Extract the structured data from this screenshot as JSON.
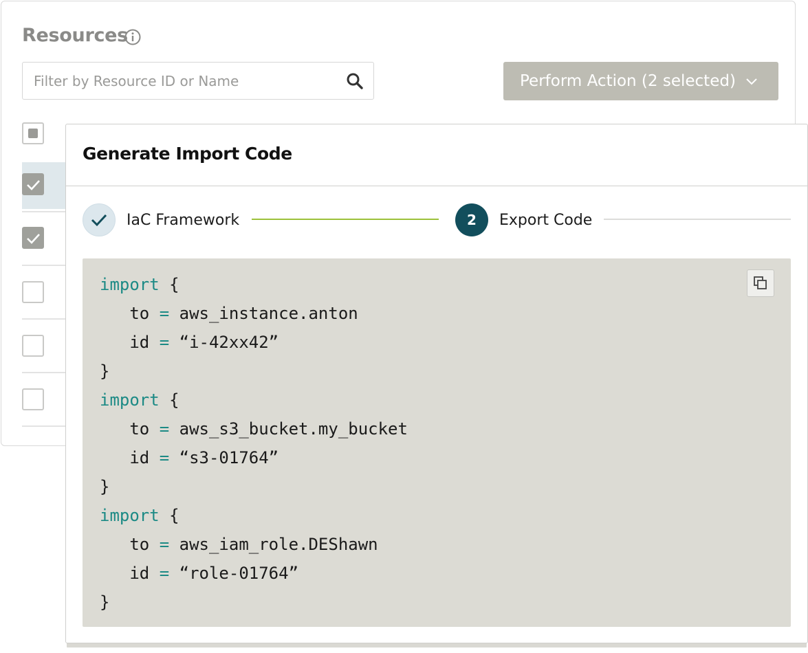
{
  "resources": {
    "title": "Resources",
    "info_icon": "info-icon",
    "search": {
      "placeholder": "Filter by Resource ID or Name",
      "value": "",
      "icon": "search-icon"
    },
    "action_button": {
      "label": "Perform Action (2 selected)",
      "icon": "chevron-down-icon"
    },
    "rows": [
      {
        "checked": "partial"
      },
      {
        "checked": true
      },
      {
        "checked": true
      },
      {
        "checked": false
      },
      {
        "checked": false
      },
      {
        "checked": false
      }
    ]
  },
  "modal": {
    "title": "Generate Import Code",
    "steps": [
      {
        "label": "IaC Framework",
        "status": "completed",
        "icon": "checkmark-icon"
      },
      {
        "number": "2",
        "label": "Export Code",
        "status": "active"
      }
    ],
    "code": {
      "copy_icon": "copy-icon",
      "blocks": [
        {
          "keyword": "import",
          "open": "{",
          "to_key": "to",
          "to_value": "aws_instance.anton",
          "id_key": "id",
          "id_value": "“i-42xx42”",
          "close": "}"
        },
        {
          "keyword": "import",
          "open": "{",
          "to_key": "to",
          "to_value": "aws_s3_bucket.my_bucket",
          "id_key": "id",
          "id_value": "“s3-01764”",
          "close": "}"
        },
        {
          "keyword": "import",
          "open": "{",
          "to_key": "to",
          "to_value": "aws_iam_role.DEShawn",
          "id_key": "id",
          "id_value": "“role-01764”",
          "close": "}"
        }
      ],
      "operator": "="
    }
  },
  "colors": {
    "accent_teal": "#124e5c",
    "keyword_teal": "#1c8a85",
    "progress_green": "#9cc13a",
    "button_gray": "#bdbcb3",
    "code_bg": "#dcdbd4"
  }
}
